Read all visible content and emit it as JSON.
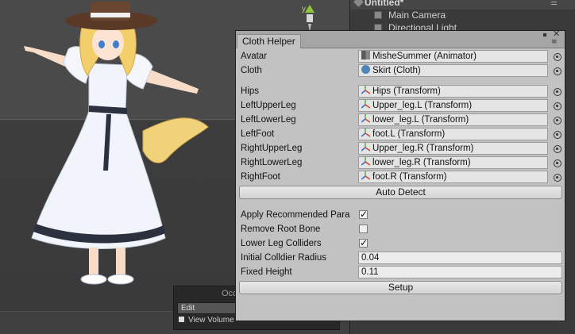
{
  "hierarchy": {
    "scene_title": "Untitled*",
    "items": [
      "Main Camera",
      "Directional Light"
    ]
  },
  "occlusion": {
    "title": "Occl",
    "edit_label": "Edit",
    "view_volumes_label": "View Volume"
  },
  "window": {
    "tab_label": "Cloth Helper"
  },
  "object_fields": [
    {
      "label": "Avatar",
      "value": "MisheSummer (Animator)",
      "icon": "animator-icon"
    },
    {
      "label": "Cloth",
      "value": "Skirt (Cloth)",
      "icon": "cloth-icon"
    },
    {
      "label": "Hips",
      "value": "Hips (Transform)",
      "icon": "transform-icon"
    },
    {
      "label": "LeftUpperLeg",
      "value": "Upper_leg.L (Transform)",
      "icon": "transform-icon"
    },
    {
      "label": "LeftLowerLeg",
      "value": "lower_leg.L (Transform)",
      "icon": "transform-icon"
    },
    {
      "label": "LeftFoot",
      "value": "foot.L (Transform)",
      "icon": "transform-icon"
    },
    {
      "label": "RightUpperLeg",
      "value": "Upper_leg.R (Transform)",
      "icon": "transform-icon"
    },
    {
      "label": "RightLowerLeg",
      "value": "lower_leg.R (Transform)",
      "icon": "transform-icon"
    },
    {
      "label": "RightFoot",
      "value": "foot.R (Transform)",
      "icon": "transform-icon"
    }
  ],
  "auto_detect_label": "Auto Detect",
  "toggles": [
    {
      "label": "Apply Recommended Para",
      "checked": true
    },
    {
      "label": "Remove Root Bone",
      "checked": false
    },
    {
      "label": "Lower Leg Colliders",
      "checked": true
    }
  ],
  "number_fields": [
    {
      "label": "Initial Colldier Radius",
      "value": "0.04"
    },
    {
      "label": "Fixed Height",
      "value": "0.11"
    }
  ],
  "setup_label": "Setup",
  "gizmo_axis_label": "y",
  "colors": {
    "window_bg": "#c2c2c2",
    "editor_dark": "#3a3a3a",
    "cloth_icon": "#4d87b8",
    "gizmo_y": "#b5d36f"
  }
}
